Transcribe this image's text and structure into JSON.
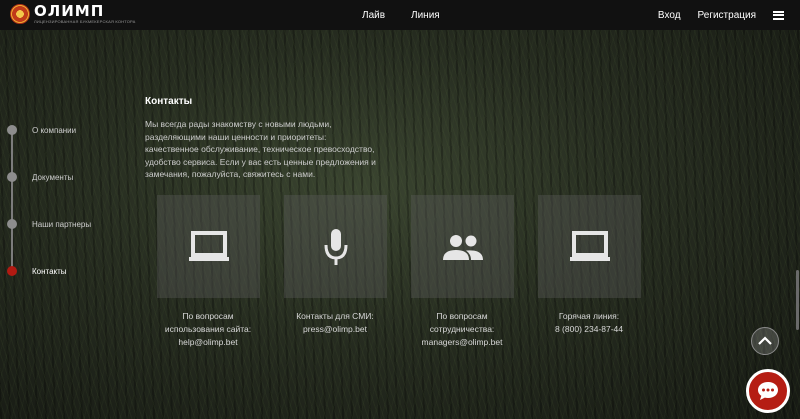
{
  "header": {
    "logo_text": "ОЛИМП",
    "logo_tagline": "ЛИЦЕНЗИРОВАННАЯ БУКМЕКЕРСКАЯ КОНТОРА",
    "nav": [
      "Лайв",
      "Линия"
    ],
    "login": "Вход",
    "register": "Регистрация"
  },
  "sidebar": {
    "items": [
      {
        "label": "О компании",
        "active": false
      },
      {
        "label": "Документы",
        "active": false
      },
      {
        "label": "Наши партнеры",
        "active": false
      },
      {
        "label": "Контакты",
        "active": true
      }
    ]
  },
  "content": {
    "heading": "Контакты",
    "intro_lines": [
      "Мы всегда рады знакомству с новыми людьми,",
      "разделяющими наши ценности и приоритеты:",
      "качественное обслуживание, техническое превосходство,",
      "удобство сервиса. Если у вас есть ценные предложения и",
      "замечания, пожалуйста, свяжитесь с нами."
    ],
    "cards": [
      {
        "icon": "laptop-icon",
        "lines": [
          "По вопросам",
          "использования сайта:",
          "help@olimp.bet"
        ]
      },
      {
        "icon": "microphone-icon",
        "lines": [
          "Контакты для СМИ:",
          "press@olimp.bet"
        ]
      },
      {
        "icon": "people-icon",
        "lines": [
          "По вопросам",
          "сотрудничества:",
          "managers@olimp.bet"
        ]
      },
      {
        "icon": "laptop-icon",
        "lines": [
          "Горячая линия:",
          "8 (800) 234-87-44"
        ]
      }
    ]
  },
  "colors": {
    "accent": "#b51d13",
    "topbar": "#111111"
  }
}
